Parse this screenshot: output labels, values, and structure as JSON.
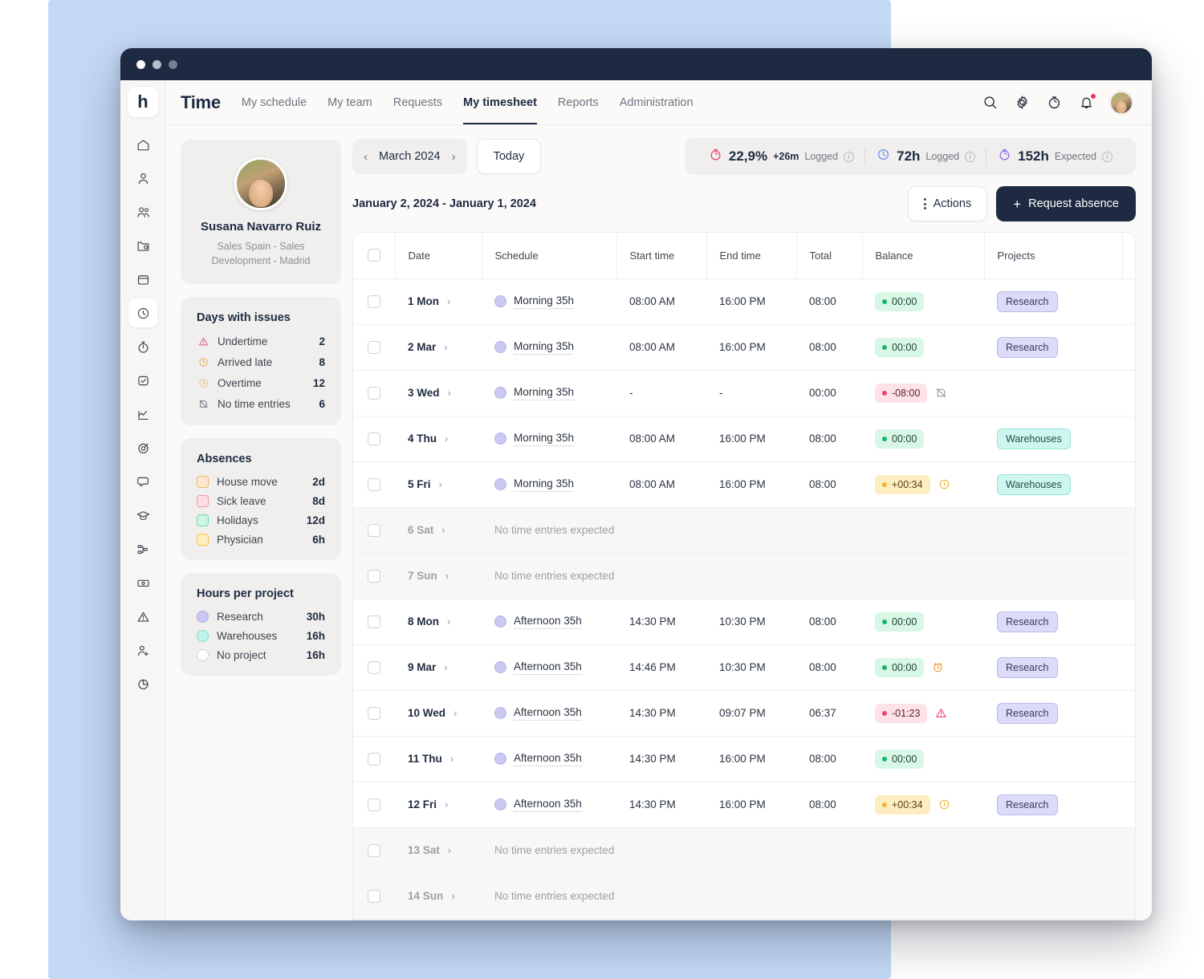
{
  "window": {
    "dots": [
      "close",
      "minimize",
      "maximize"
    ]
  },
  "header": {
    "brand": "Time",
    "nav": [
      {
        "label": "My schedule",
        "active": false
      },
      {
        "label": "My team",
        "active": false
      },
      {
        "label": "Requests",
        "active": false
      },
      {
        "label": "My timesheet",
        "active": true
      },
      {
        "label": "Reports",
        "active": false
      },
      {
        "label": "Administration",
        "active": false
      }
    ],
    "icons": [
      "search-icon",
      "gear-icon",
      "stopwatch-icon",
      "bell-icon",
      "avatar"
    ]
  },
  "rail": {
    "logo": "h",
    "items": [
      "home-icon",
      "user-icon",
      "users-icon",
      "folder-icon",
      "calendar-icon",
      "clock-icon",
      "stopwatch-icon",
      "task-check-icon",
      "analytics-icon",
      "target-icon",
      "chat-icon",
      "graduation-cap-icon",
      "workflow-icon",
      "money-icon",
      "alert-icon",
      "add-user-icon",
      "pie-chart-icon"
    ],
    "active_index": 5
  },
  "profile": {
    "name": "Susana Navarro Ruiz",
    "role_line1": "Sales Spain - Sales",
    "role_line2": "Development - Madrid"
  },
  "issues": {
    "title": "Days with issues",
    "items": [
      {
        "label": "Undertime",
        "value": "2",
        "icon": "warning-triangle-icon",
        "color": "#e8518a"
      },
      {
        "label": "Arrived late",
        "value": "8",
        "icon": "clock-icon",
        "color": "#f2a33c"
      },
      {
        "label": "Overtime",
        "value": "12",
        "icon": "clock-dashed-icon",
        "color": "#f2a33c"
      },
      {
        "label": "No time entries",
        "value": "6",
        "icon": "no-entry-icon",
        "color": "#6f7682"
      }
    ]
  },
  "absences": {
    "title": "Absences",
    "items": [
      {
        "label": "House move",
        "value": "2d",
        "fill": "#fde8cf",
        "border": "#f2b56a"
      },
      {
        "label": "Sick leave",
        "value": "8d",
        "fill": "#fcdde3",
        "border": "#f19aad"
      },
      {
        "label": "Holidays",
        "value": "12d",
        "fill": "#cdf5e2",
        "border": "#72d9ab"
      },
      {
        "label": "Physician",
        "value": "6h",
        "fill": "#fdeec2",
        "border": "#f3c43f"
      }
    ]
  },
  "projects_hours": {
    "title": "Hours per project",
    "items": [
      {
        "label": "Research",
        "value": "30h",
        "fill": "#c9c9f2",
        "border": "#a9a9e8"
      },
      {
        "label": "Warehouses",
        "value": "16h",
        "fill": "#bff3ea",
        "border": "#84ddcd"
      },
      {
        "label": "No project",
        "value": "16h",
        "fill": "#ffffff",
        "border": "#cfd2d6"
      }
    ]
  },
  "toolbar": {
    "month": "March 2024",
    "prev": "‹",
    "next": "›",
    "today_label": "Today",
    "stats": [
      {
        "value": "22,9%",
        "delta": "+26m",
        "label": "Logged",
        "icon": "stopwatch-icon",
        "color": "#f0436c"
      },
      {
        "value": "72h",
        "delta": "",
        "label": "Logged",
        "icon": "clock-icon",
        "color": "#6d8cf5"
      },
      {
        "value": "152h",
        "delta": "",
        "label": "Expected",
        "icon": "stopwatch-icon",
        "color": "#8a6df0"
      }
    ]
  },
  "subbar": {
    "range": "January 2, 2024 - January 1, 2024",
    "actions_label": "Actions",
    "request_label": "Request absence",
    "plus": "+"
  },
  "table": {
    "columns": [
      "Date",
      "Schedule",
      "Start time",
      "End time",
      "Total",
      "Balance",
      "Projects"
    ],
    "empty_text": "No time entries expected",
    "rows": [
      {
        "date": "1 Mon",
        "weekend": false,
        "schedule": "Morning 35h",
        "start": "08:00 AM",
        "end": "16:00 PM",
        "total": "08:00",
        "balance": "00:00",
        "balance_type": "green",
        "flag": "",
        "project": "Research",
        "project_type": "research",
        "note": false
      },
      {
        "date": "2 Mar",
        "weekend": false,
        "schedule": "Morning 35h",
        "start": "08:00 AM",
        "end": "16:00 PM",
        "total": "08:00",
        "balance": "00:00",
        "balance_type": "green",
        "flag": "",
        "project": "Research",
        "project_type": "research",
        "note": true
      },
      {
        "date": "3 Wed",
        "weekend": false,
        "schedule": "Morning 35h",
        "start": "-",
        "end": "-",
        "total": "00:00",
        "balance": "-08:00",
        "balance_type": "red",
        "flag": "no-entry-icon",
        "project": "",
        "project_type": "",
        "note": false
      },
      {
        "date": "4 Thu",
        "weekend": false,
        "schedule": "Morning 35h",
        "start": "08:00 AM",
        "end": "16:00 PM",
        "total": "08:00",
        "balance": "00:00",
        "balance_type": "green",
        "flag": "",
        "project": "Warehouses",
        "project_type": "warehouses",
        "note": false
      },
      {
        "date": "5 Fri",
        "weekend": false,
        "schedule": "Morning 35h",
        "start": "08:00 AM",
        "end": "16:00 PM",
        "total": "08:00",
        "balance": "+00:34",
        "balance_type": "yellow",
        "flag": "clock-icon",
        "project": "Warehouses",
        "project_type": "warehouses",
        "note": true
      },
      {
        "date": "6 Sat",
        "weekend": true,
        "schedule": "",
        "start": "",
        "end": "",
        "total": "",
        "balance": "",
        "balance_type": "",
        "flag": "",
        "project": "",
        "project_type": "",
        "note": false
      },
      {
        "date": "7 Sun",
        "weekend": true,
        "schedule": "",
        "start": "",
        "end": "",
        "total": "",
        "balance": "",
        "balance_type": "",
        "flag": "",
        "project": "",
        "project_type": "",
        "note": false
      },
      {
        "date": "8 Mon",
        "weekend": false,
        "schedule": "Afternoon 35h",
        "start": "14:30 PM",
        "end": "10:30 PM",
        "total": "08:00",
        "balance": "00:00",
        "balance_type": "green",
        "flag": "",
        "project": "Research",
        "project_type": "research",
        "note": false
      },
      {
        "date": "9 Mar",
        "weekend": false,
        "schedule": "Afternoon 35h",
        "start": "14:46 PM",
        "end": "10:30 PM",
        "total": "08:00",
        "balance": "00:00",
        "balance_type": "green",
        "flag": "alarm-icon",
        "project": "Research",
        "project_type": "research",
        "note": true
      },
      {
        "date": "10 Wed",
        "weekend": false,
        "schedule": "Afternoon 35h",
        "start": "14:30 PM",
        "end": "09:07 PM",
        "total": "06:37",
        "balance": "-01:23",
        "balance_type": "red",
        "flag": "warning-triangle-icon",
        "project": "Research",
        "project_type": "research",
        "note": false
      },
      {
        "date": "11 Thu",
        "weekend": false,
        "schedule": "Afternoon 35h",
        "start": "14:30 PM",
        "end": "16:00 PM",
        "total": "08:00",
        "balance": "00:00",
        "balance_type": "green",
        "flag": "",
        "project": "",
        "project_type": "",
        "note": false
      },
      {
        "date": "12 Fri",
        "weekend": false,
        "schedule": "Afternoon 35h",
        "start": "14:30 PM",
        "end": "16:00 PM",
        "total": "08:00",
        "balance": "+00:34",
        "balance_type": "yellow",
        "flag": "clock-icon",
        "project": "Research",
        "project_type": "research",
        "note": true
      },
      {
        "date": "13 Sat",
        "weekend": true,
        "schedule": "",
        "start": "",
        "end": "",
        "total": "",
        "balance": "",
        "balance_type": "",
        "flag": "",
        "project": "",
        "project_type": "",
        "note": false
      },
      {
        "date": "14 Sun",
        "weekend": true,
        "schedule": "",
        "start": "",
        "end": "",
        "total": "",
        "balance": "",
        "balance_type": "",
        "flag": "",
        "project": "",
        "project_type": "",
        "note": false
      }
    ]
  }
}
